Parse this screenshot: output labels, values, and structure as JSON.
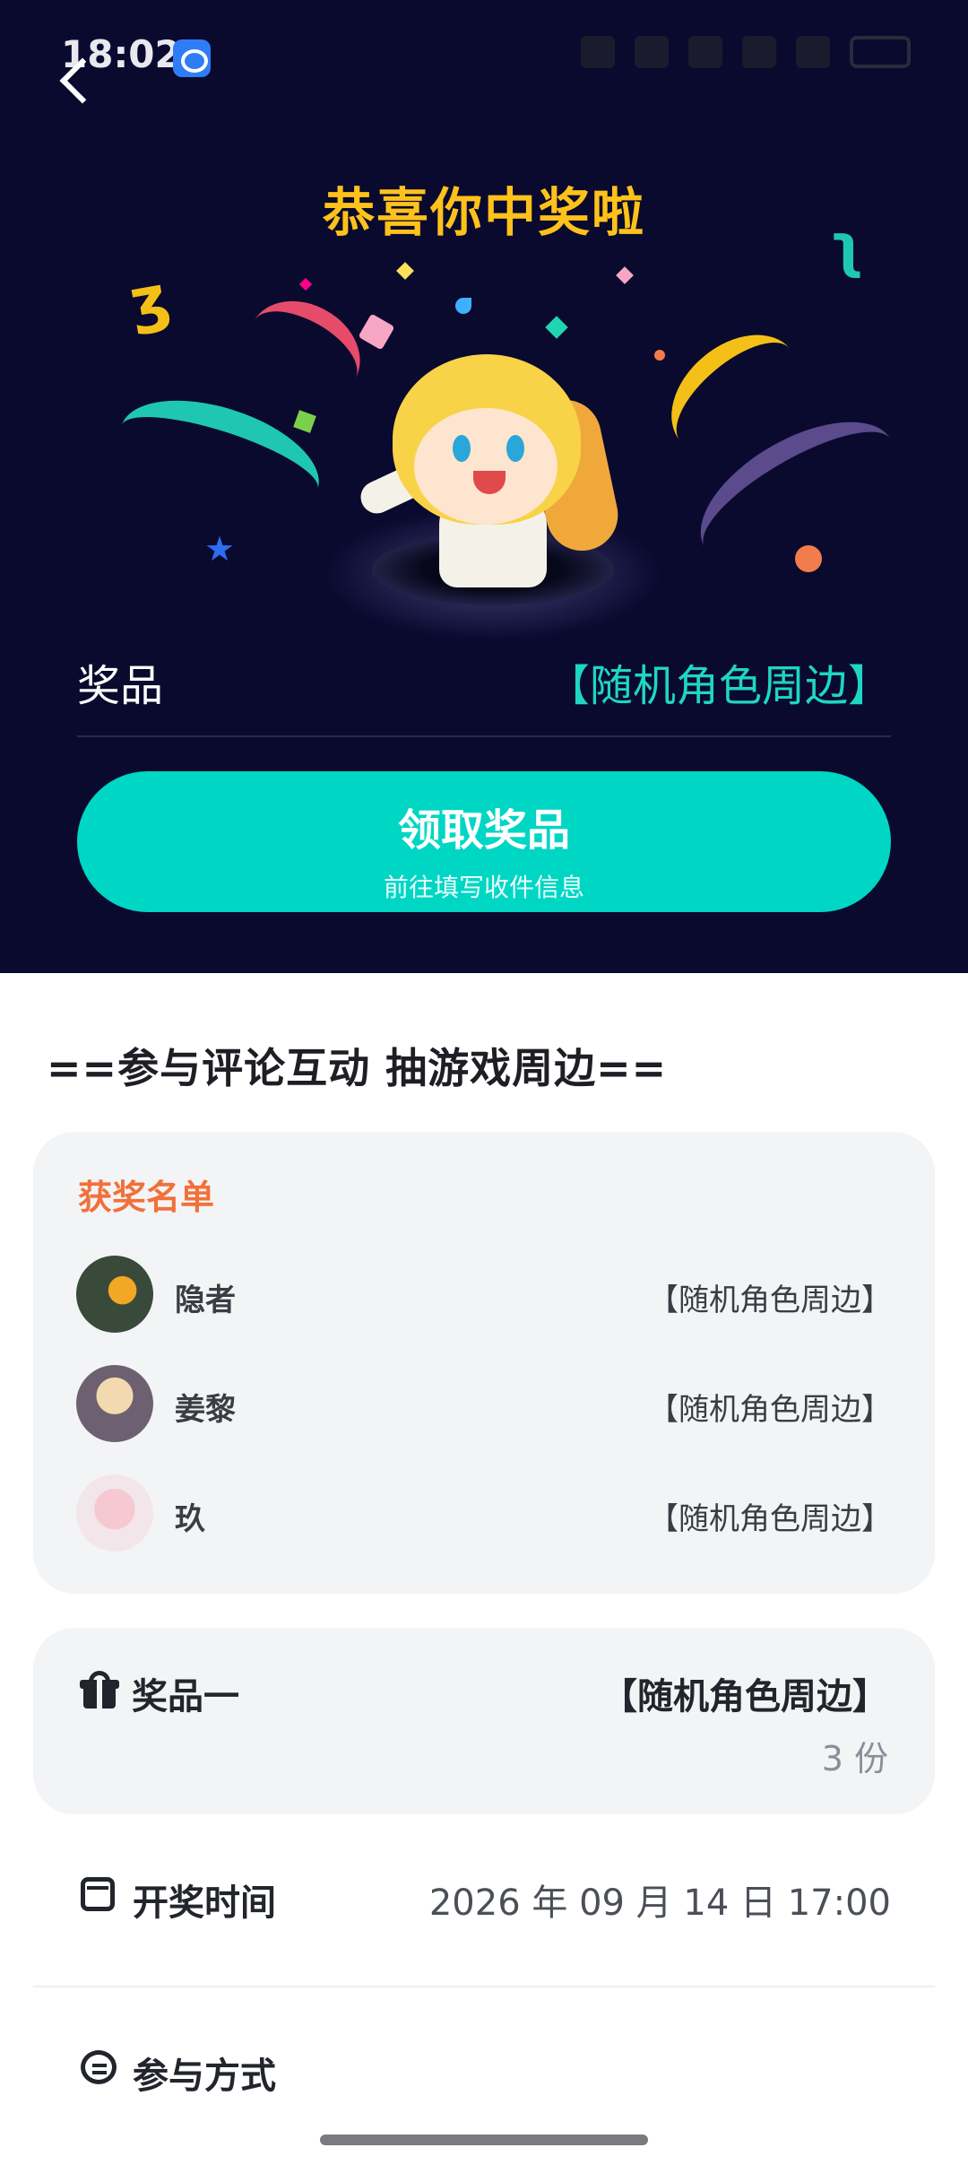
{
  "status_bar": {
    "time": "18:02"
  },
  "hero": {
    "congrats": "恭喜你中奖啦",
    "prize_label": "奖品",
    "prize_value": "【随机角色周边】",
    "claim_button": {
      "title": "领取奖品",
      "subtitle": "前往填写收件信息"
    }
  },
  "event": {
    "title": "==参与评论互动 抽游戏周边=="
  },
  "winners": {
    "title": "获奖名单",
    "list": [
      {
        "name": "隐者",
        "prize": "【随机角色周边】"
      },
      {
        "name": "姜黎",
        "prize": "【随机角色周边】"
      },
      {
        "name": "玖",
        "prize": "【随机角色周边】"
      }
    ]
  },
  "prize_one": {
    "label": "奖品一",
    "value": "【随机角色周边】",
    "count": "3 份"
  },
  "draw_time": {
    "label": "开奖时间",
    "value": "2026 年 09 月 14 日 17:00"
  },
  "join_method": {
    "label": "参与方式"
  },
  "colors": {
    "hero_bg": "#0a0a2f",
    "accent": "#00d6c4",
    "congrats": "#ffc21a",
    "winners_title": "#f2703a"
  }
}
